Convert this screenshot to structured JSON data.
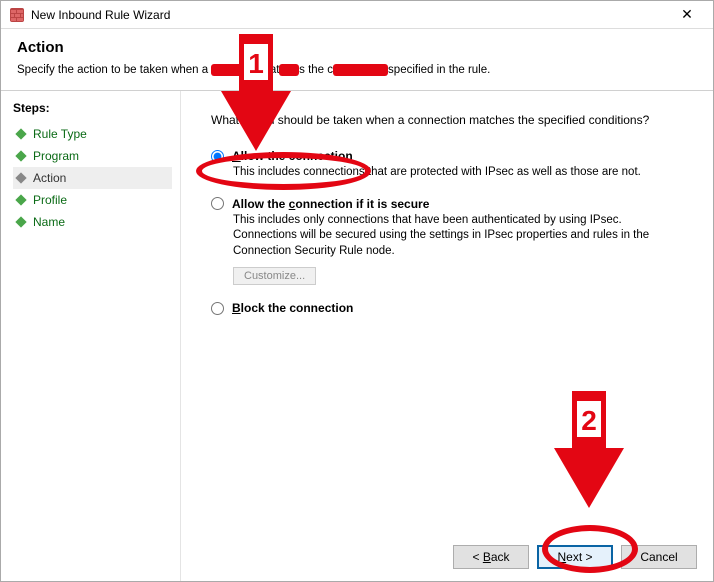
{
  "window": {
    "title": "New Inbound Rule Wizard",
    "close_glyph": "✕"
  },
  "header": {
    "title": "Action",
    "subtitle_pre": "Specify the action to be taken when a ",
    "subtitle_mid1": "n mat",
    "subtitle_mid2": "s the c",
    "subtitle_post": "specified in the rule."
  },
  "steps": {
    "title": "Steps:",
    "items": [
      "Rule Type",
      "Program",
      "Action",
      "Profile",
      "Name"
    ],
    "active_index": 2
  },
  "main": {
    "question": "What action should be taken when a connection matches the specified conditions?",
    "options": {
      "allow": {
        "label_u": "A",
        "label_rest": "llow the connection",
        "desc": "This includes connections that are protected with IPsec as well as those are not.",
        "checked": true
      },
      "allow_secure": {
        "label_pre": "Allow the ",
        "label_u": "c",
        "label_rest": "onnection if it is secure",
        "desc": "This includes only connections that have been authenticated by using IPsec.  Connections will be secured using the settings in IPsec properties and rules in the Connection Security Rule node.",
        "customize": "Customize...",
        "checked": false
      },
      "block": {
        "label_u": "B",
        "label_rest": "lock the connection",
        "checked": false
      }
    }
  },
  "buttons": {
    "back_lt": "<",
    "back_u": "B",
    "back_rest": "ack",
    "next_u": "N",
    "next_rest": "ext >",
    "cancel": "Cancel"
  },
  "annotations": {
    "num1": "1",
    "num2": "2"
  }
}
